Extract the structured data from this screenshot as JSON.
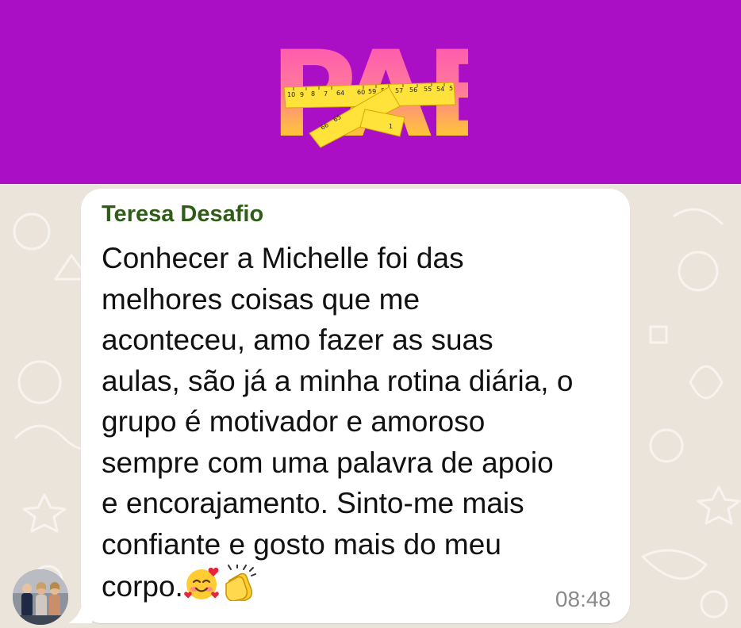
{
  "banner": {
    "logo_text": "PAB",
    "background_color": "#aa0fc6",
    "tape_numbers": [
      "10",
      "9",
      "8",
      "7",
      "64",
      "60",
      "59",
      "58",
      "57",
      "56",
      "55",
      "54",
      "5",
      "66",
      "65",
      "1"
    ]
  },
  "chat": {
    "message": {
      "sender_name": "Teresa Desafio",
      "sender_color": "#2f5d17",
      "lines": [
        "Conhecer a Michelle foi das",
        "melhores coisas que me",
        "aconteceu, amo fazer as suas",
        "aulas, são já a minha rotina diária, o",
        "grupo é motivador e amoroso",
        "sempre com uma palavra de apoio",
        "e encorajamento. Sinto-me mais",
        "confiante e gosto mais do meu",
        "corpo."
      ],
      "emojis": [
        "smiling-face-with-hearts-icon",
        "clapping-hands-icon"
      ],
      "time": "08:48"
    },
    "avatar": "group-photo-avatar"
  }
}
